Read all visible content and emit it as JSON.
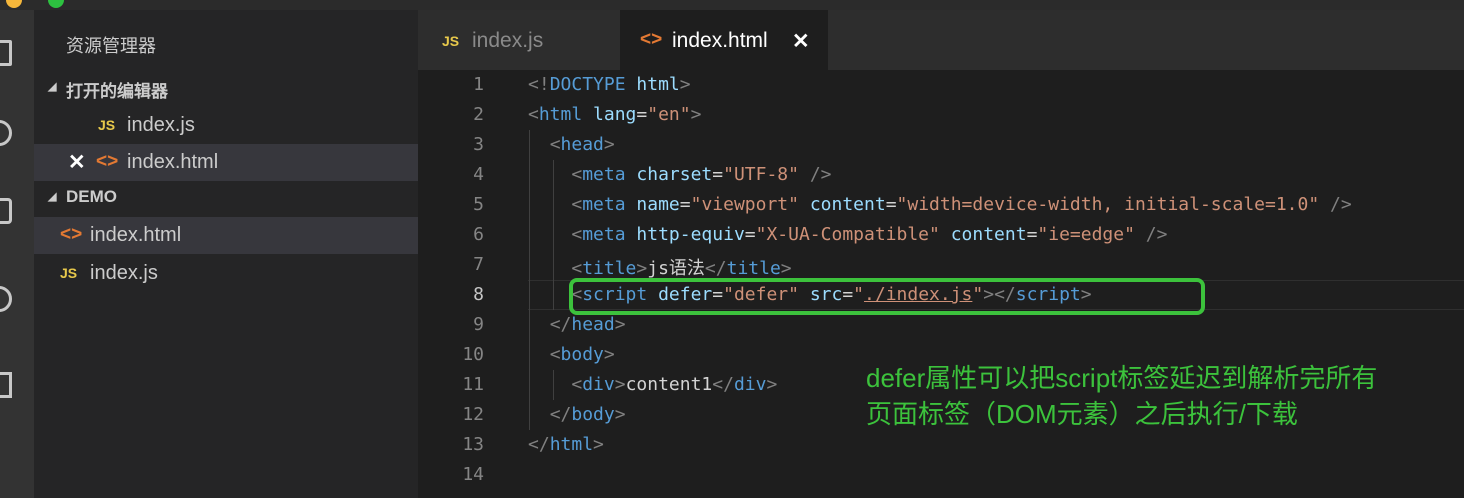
{
  "sidebar": {
    "title": "资源管理器",
    "open_editors": {
      "label": "打开的编辑器",
      "items": [
        {
          "icon": "JS",
          "name": "index.js"
        },
        {
          "icon": "<>",
          "name": "index.html",
          "close": "✕"
        }
      ]
    },
    "project": {
      "label": "DEMO",
      "items": [
        {
          "icon": "<>",
          "name": "index.html"
        },
        {
          "icon": "JS",
          "name": "index.js"
        }
      ]
    }
  },
  "tabs": [
    {
      "icon": "JS",
      "label": "index.js",
      "active": false
    },
    {
      "icon": "<>",
      "label": "index.html",
      "active": true,
      "close": "✕"
    }
  ],
  "editor": {
    "line_numbers": [
      "1",
      "2",
      "3",
      "4",
      "5",
      "6",
      "7",
      "8",
      "9",
      "10",
      "11",
      "12",
      "13",
      "14"
    ],
    "current_line": 8
  },
  "annotation": {
    "line1": "defer属性可以把script标签延迟到解析完所有",
    "line2": "页面标签（DOM元素）之后执行/下载",
    "color": "#3cc23c"
  },
  "colors": {
    "tag": "#569cd6",
    "attr": "#9cdcfe",
    "string": "#ce9178",
    "js_icon": "#e8c94b",
    "html_icon": "#e37933",
    "annotation": "#3cc23c"
  }
}
